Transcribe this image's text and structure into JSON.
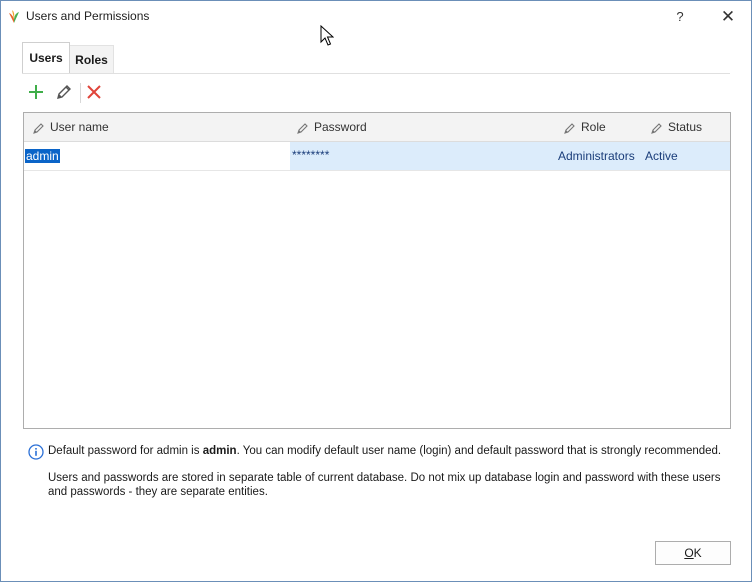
{
  "window": {
    "title": "Users and Permissions",
    "help": "?",
    "close": "✕"
  },
  "tabs": [
    {
      "label": "Users",
      "active": true
    },
    {
      "label": "Roles",
      "active": false
    }
  ],
  "toolbar": {
    "add": "add-icon",
    "edit": "pencil-icon",
    "delete": "delete-icon"
  },
  "grid": {
    "columns": [
      "User name",
      "Password",
      "Role",
      "Status"
    ],
    "rows": [
      {
        "user": "admin",
        "password": "********",
        "role": "Administrators",
        "status": "Active"
      }
    ]
  },
  "info": {
    "line1_pre": "Default password for admin is ",
    "line1_bold": "admin",
    "line1_post": ". You can modify default user name (login) and default password that is strongly recommended.",
    "line2": "Users and passwords are stored in separate table of current database. Do not mix up database login and password with these users and passwords - they are separate entities."
  },
  "buttons": {
    "ok_mnemonic": "O",
    "ok_rest": "K"
  },
  "colors": {
    "accent": "#0a64c8",
    "selection": "#dcecfb",
    "add": "#3fae49",
    "delete": "#e0443a"
  }
}
